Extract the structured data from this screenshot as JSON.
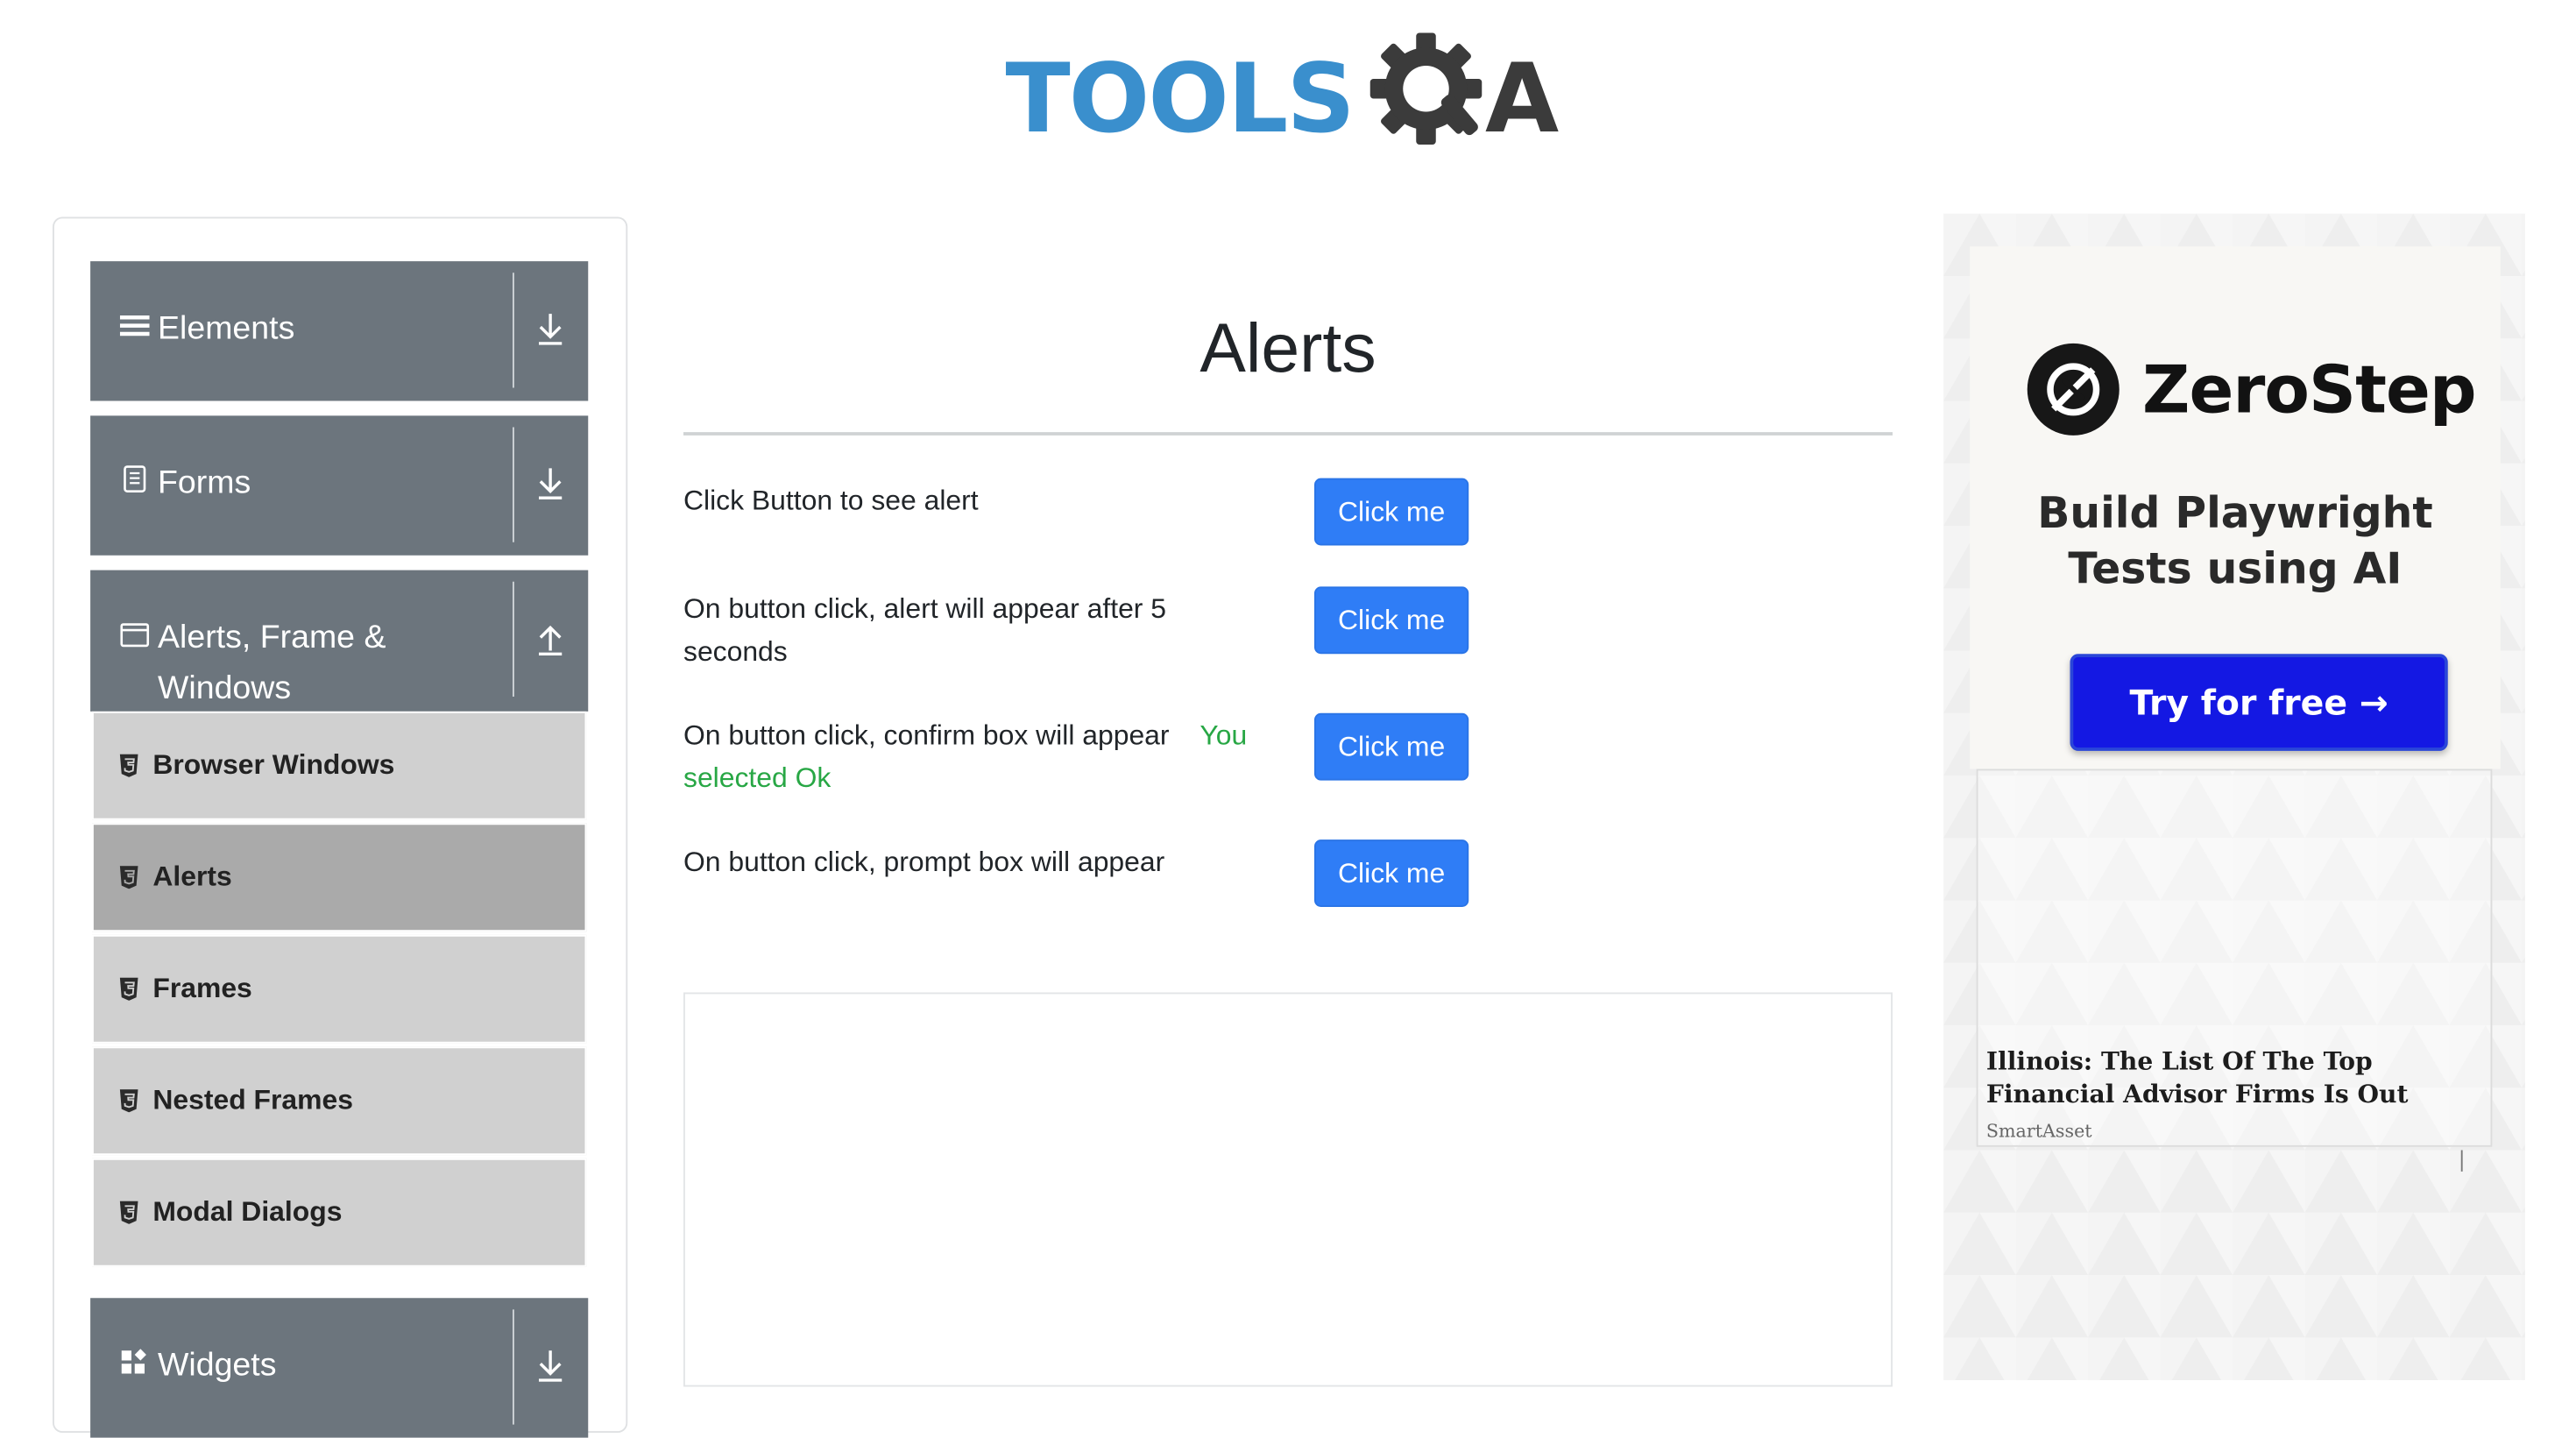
{
  "header": {
    "logo_text": "TOOLSQA",
    "logo_tools": "TOOLS",
    "logo_a": "A"
  },
  "sidebar": {
    "groups": [
      {
        "label": "Elements",
        "icon": "hamburger-icon",
        "expanded": false
      },
      {
        "label": "Forms",
        "icon": "document-icon",
        "expanded": false
      },
      {
        "label": "Alerts, Frame &",
        "label_line2": "Windows",
        "icon": "window-icon",
        "expanded": true
      },
      {
        "label": "Widgets",
        "icon": "widgets-icon",
        "expanded": false
      }
    ],
    "items": [
      {
        "label": "Browser Windows",
        "active": false
      },
      {
        "label": "Alerts",
        "active": true
      },
      {
        "label": "Frames",
        "active": false
      },
      {
        "label": "Nested Frames",
        "active": false
      },
      {
        "label": "Modal Dialogs",
        "active": false
      }
    ]
  },
  "main": {
    "title": "Alerts",
    "rows": [
      {
        "label": "Click Button to see alert",
        "button": "Click me"
      },
      {
        "label": "On button click, alert will appear after 5 seconds",
        "button": "Click me"
      },
      {
        "label": "On button click, confirm box will appear",
        "result_text": "You selected Ok",
        "button": "Click me"
      },
      {
        "label": "On button click, prompt box will appear",
        "button": "Click me"
      }
    ]
  },
  "ad": {
    "brand": "ZeroStep",
    "headline_line1": "Build Playwright",
    "headline_line2": "Tests using AI",
    "cta": "Try for free →",
    "cta_color": "#1418e3",
    "news_headline": "Illinois: The List Of The Top Financial Advisor Firms Is Out",
    "news_source": "SmartAsset"
  },
  "colors": {
    "sidebar_header": "#6c757d",
    "sidebar_item": "#d0d0d0",
    "sidebar_item_active": "#aaaaaa",
    "button": "#2f7df6",
    "result": "#28a745",
    "logo_blue": "#3a8fcd"
  }
}
